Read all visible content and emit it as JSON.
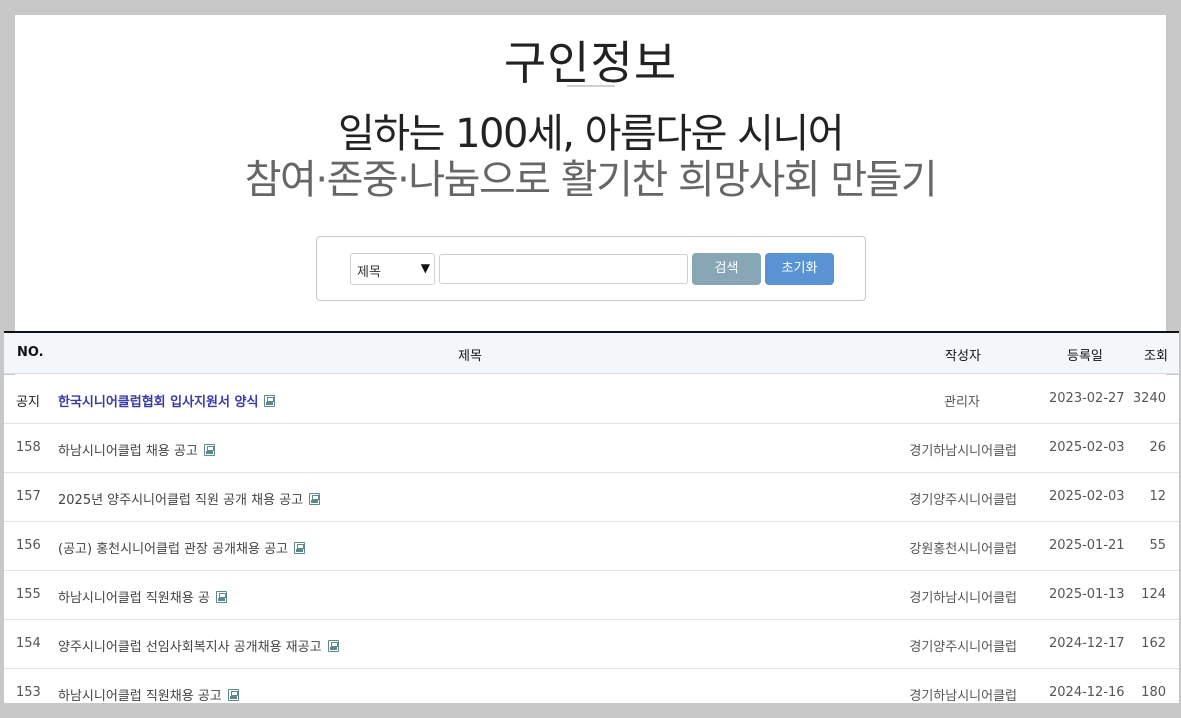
{
  "page": {
    "title": "구인정보",
    "slogan_line1": "일하는 100세, 아름다운 시니어",
    "slogan_line2": "참여·존중·나눔으로 활기찬 희망사회 만들기"
  },
  "search": {
    "select_value": "제목",
    "input_value": "",
    "search_button": "검색",
    "reset_button": "초기화"
  },
  "table": {
    "headers": {
      "no": "NO.",
      "title": "제목",
      "author": "작성자",
      "date": "등록일",
      "views": "조회"
    },
    "rows": [
      {
        "no": "공지",
        "title": "한국시니어클럽협회 입사지원서 양식",
        "author": "관리자",
        "date": "2023-02-27",
        "views": "3240",
        "notice": true
      },
      {
        "no": "158",
        "title": "하남시니어클럽 채용 공고",
        "author": "경기하남시니어클럽",
        "date": "2025-02-03",
        "views": "26"
      },
      {
        "no": "157",
        "title": "2025년 양주시니어클럽 직원 공개 채용 공고",
        "author": "경기양주시니어클럽",
        "date": "2025-02-03",
        "views": "12"
      },
      {
        "no": "156",
        "title": "(공고) 홍천시니어클럽 관장 공개채용 공고",
        "author": "강원홍천시니어클럽",
        "date": "2025-01-21",
        "views": "55"
      },
      {
        "no": "155",
        "title": "하남시니어클럽 직원채용 공",
        "author": "경기하남시니어클럽",
        "date": "2025-01-13",
        "views": "124"
      },
      {
        "no": "154",
        "title": "양주시니어클럽 선임사회복지사 공개채용 재공고",
        "author": "경기양주시니어클럽",
        "date": "2024-12-17",
        "views": "162"
      },
      {
        "no": "153",
        "title": "하남시니어클럽 직원채용 공고",
        "author": "경기하남시니어클럽",
        "date": "2024-12-16",
        "views": "180"
      }
    ]
  },
  "icons": {
    "attachment": "file-attachment-icon",
    "dropdown": "chevron-down-icon"
  }
}
